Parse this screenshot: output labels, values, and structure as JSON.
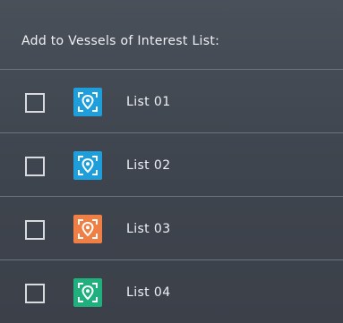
{
  "header": {
    "title": "Add to Vessels of Interest List:"
  },
  "lists": [
    {
      "label": "List 01",
      "color": "#1e9fdc",
      "icon": "location-pin-icon",
      "checked": false
    },
    {
      "label": "List 02",
      "color": "#1e9fdc",
      "icon": "location-pin-icon",
      "checked": false
    },
    {
      "label": "List 03",
      "color": "#ef7f45",
      "icon": "location-pin-icon",
      "checked": false
    },
    {
      "label": "List 04",
      "color": "#1fb07e",
      "icon": "location-pin-icon",
      "checked": false
    }
  ]
}
